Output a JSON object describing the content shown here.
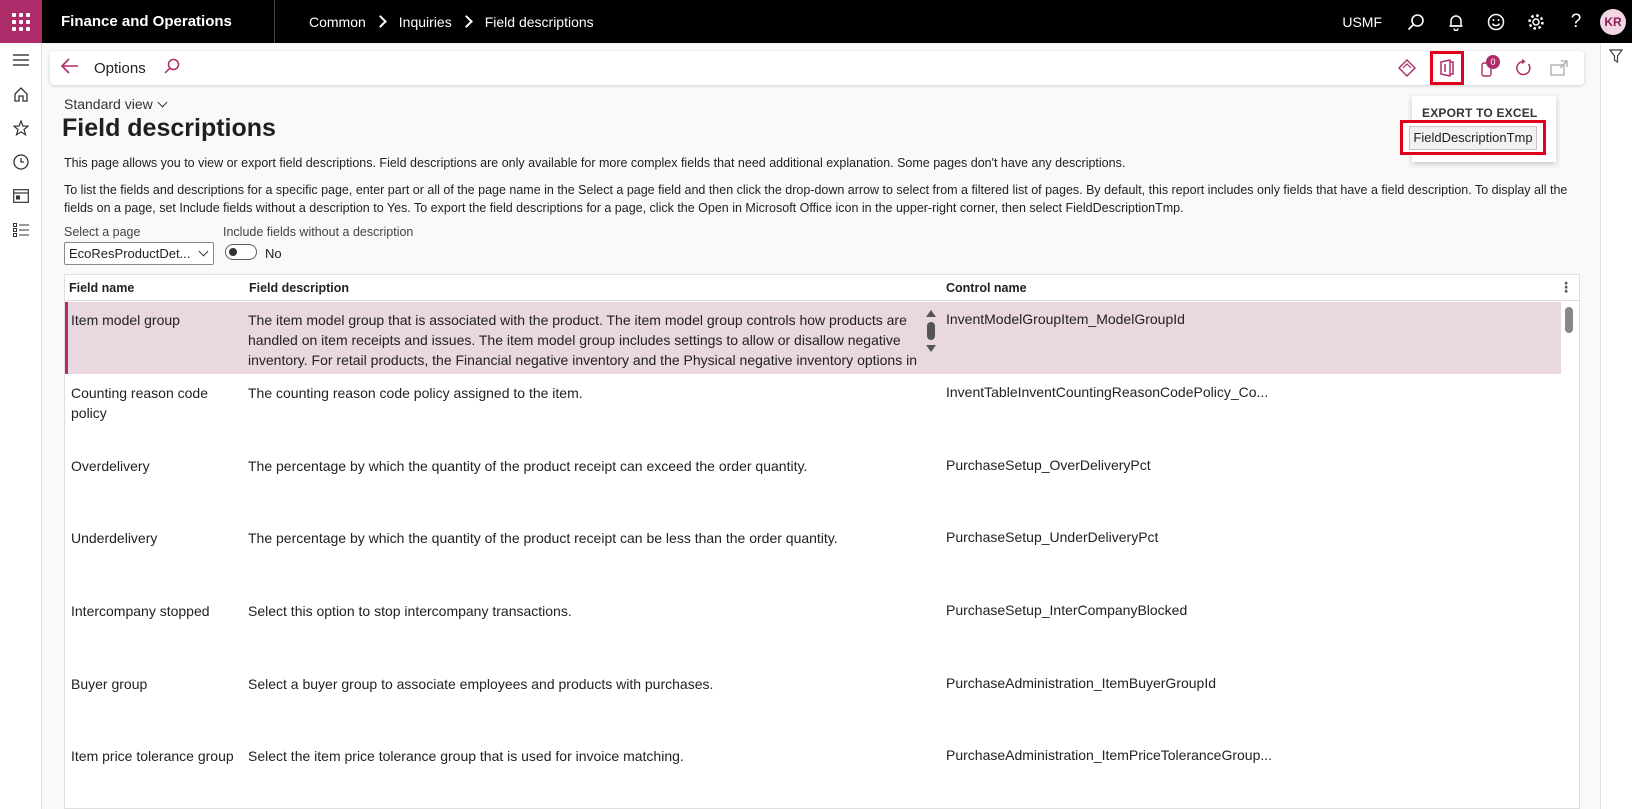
{
  "topbar": {
    "app_name": "Finance and Operations",
    "breadcrumb": [
      "Common",
      "Inquiries",
      "Field descriptions"
    ],
    "company": "USMF",
    "avatar_initials": "KR",
    "icons": [
      "search-icon",
      "bell-icon",
      "smiley-icon",
      "gear-icon",
      "help-icon"
    ]
  },
  "leftnav": {
    "icons": [
      "hamburger-icon",
      "home-icon",
      "star-icon",
      "clock-icon",
      "workspace-icon",
      "list-icon"
    ]
  },
  "actionpane": {
    "label": "Options",
    "badge_count": "0",
    "icons": [
      "diamond-icon",
      "office-icon",
      "attachment-icon",
      "refresh-icon",
      "popout-icon"
    ]
  },
  "export_menu": {
    "title": "EXPORT TO EXCEL",
    "item": "FieldDescriptionTmp"
  },
  "header": {
    "view": "Standard view",
    "title": "Field descriptions",
    "description1": "This page allows you to view or export field descriptions. Field descriptions are only available for more complex fields that need additional explanation. Some pages don't have any descriptions.",
    "description2": "To list the fields and descriptions for a specific page, enter part or all of the page name in the Select a page field and then click the drop-down arrow to select from a filtered list of pages. By default, this report includes only fields that have a field description. To display all the fields on a page, set Include fields without a description to Yes. To export the field descriptions for a page, click the Open in Microsoft Office icon in the upper-right corner, then select FieldDescriptionTmp."
  },
  "filters": {
    "select_page_label": "Select a page",
    "select_page_value": "EcoResProductDet...",
    "include_label": "Include fields without a description",
    "include_value": "No"
  },
  "grid": {
    "columns": [
      "Field name",
      "Field description",
      "Control name"
    ],
    "rows": [
      {
        "name": "Item model group",
        "description": "The item model group that is associated with the product. The item model group controls how products are handled on item receipts and issues. The item model group includes settings to allow or disallow negative inventory. For retail products, the Financial negative inventory and the Physical negative inventory options in",
        "control": "InventModelGroupItem_ModelGroupId"
      },
      {
        "name": "Counting reason code policy",
        "description": "The counting reason code policy assigned to the item.",
        "control": "InventTableInventCountingReasonCodePolicy_Co..."
      },
      {
        "name": "Overdelivery",
        "description": "The percentage by which the quantity of the product receipt can exceed the order quantity.",
        "control": "PurchaseSetup_OverDeliveryPct"
      },
      {
        "name": "Underdelivery",
        "description": "The percentage by which the quantity of the product receipt can be less than the order quantity.",
        "control": "PurchaseSetup_UnderDeliveryPct"
      },
      {
        "name": "Intercompany stopped",
        "description": "Select this option to stop intercompany transactions.",
        "control": "PurchaseSetup_InterCompanyBlocked"
      },
      {
        "name": "Buyer group",
        "description": "Select a buyer group to associate employees and products with purchases.",
        "control": "PurchaseAdministration_ItemBuyerGroupId"
      },
      {
        "name": "Item price tolerance group",
        "description": "Select the item price tolerance group that is used for invoice matching.",
        "control": "PurchaseAdministration_ItemPriceToleranceGroup..."
      }
    ]
  }
}
